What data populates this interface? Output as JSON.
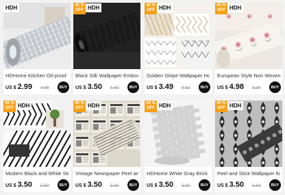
{
  "products": [
    {
      "brand": "HDH",
      "off_label": "",
      "title": "HDHome Kitchen Oil-proof",
      "currency": "US $",
      "price": "2.99",
      "old_price": "4.98",
      "buy_label": "BUY",
      "theme": "foil"
    },
    {
      "brand": "HDH",
      "off_label": "40 %\nOFF",
      "title": "Black Silk Wallpaper Embossed",
      "currency": "US $",
      "price": "3.50",
      "old_price": "5.83",
      "buy_label": "BUY",
      "theme": "black"
    },
    {
      "brand": "HDH",
      "off_label": "40 %\nOFF",
      "title": "Golden Stripe Wallpaper Home",
      "currency": "US $",
      "price": "3.49",
      "old_price": "5.82",
      "buy_label": "BUY",
      "theme": "stripe"
    },
    {
      "brand": "HDH",
      "off_label": "40 %\nOFF",
      "title": "European Style Non Woven Peel",
      "currency": "US $",
      "price": "4.98",
      "old_price": "8.30",
      "buy_label": "BUY",
      "theme": "floral"
    },
    {
      "brand": "HDH",
      "off_label": "40 %\nOFF",
      "title": "Modern Black and White Stripe",
      "currency": "US $",
      "price": "3.50",
      "old_price": "5.83",
      "buy_label": "BUY",
      "theme": "bw"
    },
    {
      "brand": "HDH",
      "off_label": "40 %\nOFF",
      "title": "Vintage Newspaper Peel and",
      "currency": "US $",
      "price": "3.50",
      "old_price": "5.83",
      "buy_label": "BUY",
      "theme": "news"
    },
    {
      "brand": "HDH",
      "off_label": "40 %\nOFF",
      "title": "HDHome White Gray Brick",
      "currency": "US $",
      "price": "3.50",
      "old_price": "5.83",
      "buy_label": "BUY",
      "theme": "brick"
    },
    {
      "brand": "HDH",
      "off_label": "40 %\nOFF",
      "title": "Peel and Stick Wallpaper for",
      "currency": "US $",
      "price": "3.50",
      "old_price": "5.83",
      "buy_label": "BUY",
      "theme": "damask"
    }
  ]
}
